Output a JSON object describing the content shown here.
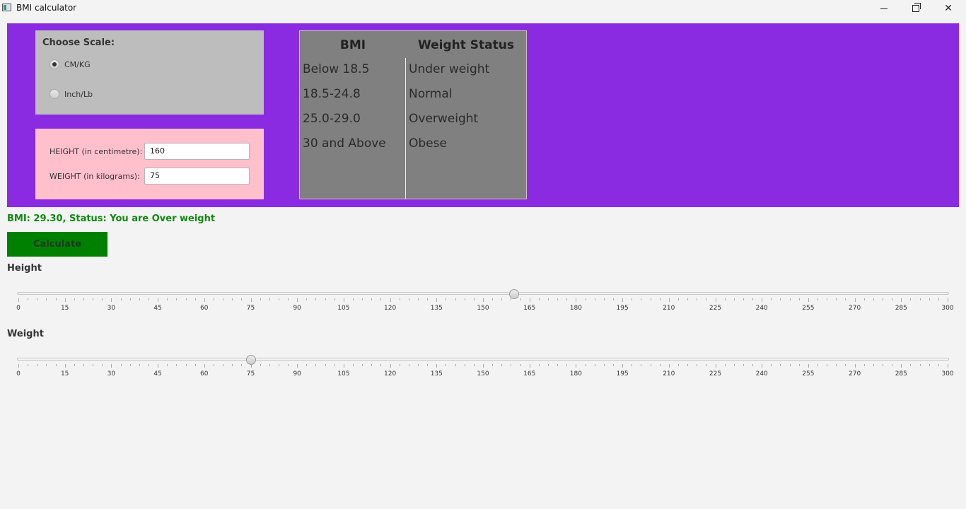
{
  "window": {
    "title": "BMI calculator"
  },
  "scale": {
    "title": "Choose Scale:",
    "options": [
      {
        "label": "CM/KG",
        "selected": true
      },
      {
        "label": "Inch/Lb",
        "selected": false
      }
    ]
  },
  "inputs": {
    "height_label": "HEIGHT (in centimetre):",
    "height_value": "160",
    "weight_label": "WEIGHT (in kilograms):",
    "weight_value": "75"
  },
  "table": {
    "headers": [
      "BMI",
      "Weight Status"
    ],
    "rows": [
      [
        "Below 18.5",
        "Under weight"
      ],
      [
        "18.5-24.8",
        "Normal"
      ],
      [
        "25.0-29.0",
        "Overweight"
      ],
      [
        "30 and Above",
        "Obese"
      ]
    ]
  },
  "result": {
    "text": "BMI: 29.30, Status: You are Over weight"
  },
  "calculate_label": "Calculate",
  "sliders": {
    "height": {
      "label": "Height",
      "value": 160,
      "min": 0,
      "max": 300,
      "major_tick": 15,
      "minor_tick": 3
    },
    "weight": {
      "label": "Weight",
      "value": 75,
      "min": 0,
      "max": 300,
      "major_tick": 15,
      "minor_tick": 3
    }
  },
  "tick_labels": [
    "0",
    "15",
    "30",
    "45",
    "60",
    "75",
    "90",
    "105",
    "120",
    "135",
    "150",
    "165",
    "180",
    "195",
    "210",
    "225",
    "240",
    "255",
    "270",
    "285",
    "300"
  ],
  "colors": {
    "top_panel": "#8a2be2",
    "scale_box": "#bdbdbd",
    "input_box": "#ffc0cb",
    "table_bg": "#808080",
    "status_text": "#118811",
    "calculate_button": "#008000"
  }
}
